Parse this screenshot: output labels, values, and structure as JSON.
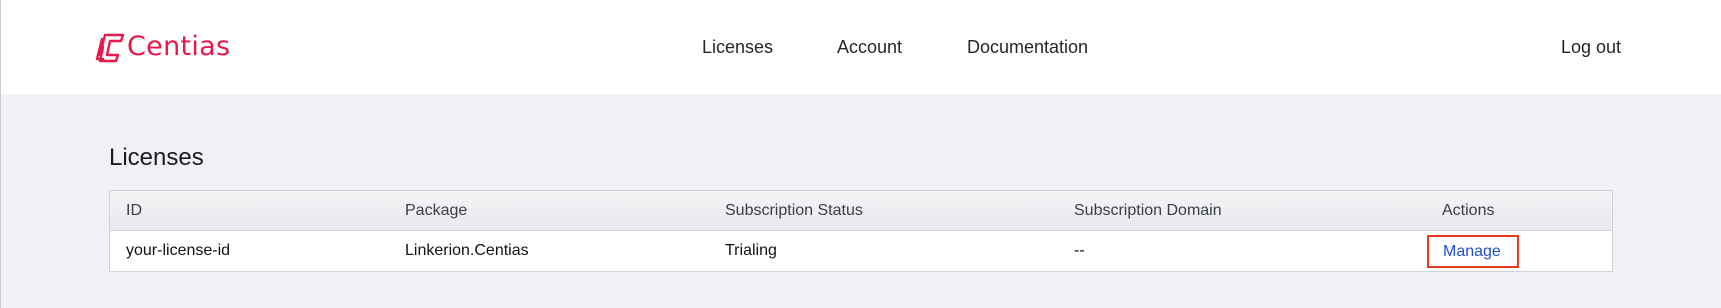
{
  "brand": {
    "name": "Centias",
    "color": "#e8194a",
    "logo_icon": "centias-logo-icon"
  },
  "nav": {
    "licenses": "Licenses",
    "account": "Account",
    "documentation": "Documentation",
    "logout": "Log out"
  },
  "page": {
    "title": "Licenses"
  },
  "table": {
    "headers": [
      "ID",
      "Package",
      "Subscription Status",
      "Subscription Domain",
      "Actions"
    ],
    "rows": [
      {
        "id": "your-license-id",
        "package": "Linkerion.Centias",
        "status": "Trialing",
        "domain": "--",
        "action": "Manage"
      }
    ]
  },
  "colors": {
    "link": "#1f4fd8",
    "highlight_border": "#e8381f",
    "background": "#f0f1f4"
  }
}
